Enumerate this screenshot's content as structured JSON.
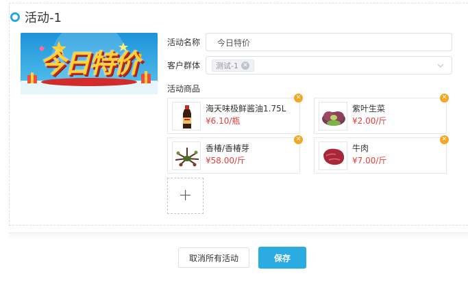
{
  "activity": {
    "title": "活动-1"
  },
  "form": {
    "name_label": "活动名称",
    "name_value": "今日特价",
    "group_label": "客户群体",
    "group_tag": "测试-1",
    "products_label": "活动商品"
  },
  "banner": {
    "text": "今日特价",
    "colors": {
      "sky": "#2fa8e6",
      "text": "#ffd23a",
      "red": "#e0342a"
    }
  },
  "products": [
    {
      "name": "海天味极鲜酱油1.75L",
      "price": "¥6.10/瓶",
      "icon": "soy-sauce-bottle"
    },
    {
      "name": "紫叶生菜",
      "price": "¥2.00/斤",
      "icon": "purple-lettuce"
    },
    {
      "name": "香椿/香椿芽",
      "price": "¥58.00/斤",
      "icon": "toona-sprouts"
    },
    {
      "name": "牛肉",
      "price": "¥7.00/斤",
      "icon": "beef"
    }
  ],
  "add_product": {
    "symbol": "+"
  },
  "buttons": {
    "cancel_all": "取消所有活动",
    "save": "保存"
  },
  "colors": {
    "accent": "#2aace2",
    "price": "#e63c3c",
    "remove": "#f5a623"
  }
}
